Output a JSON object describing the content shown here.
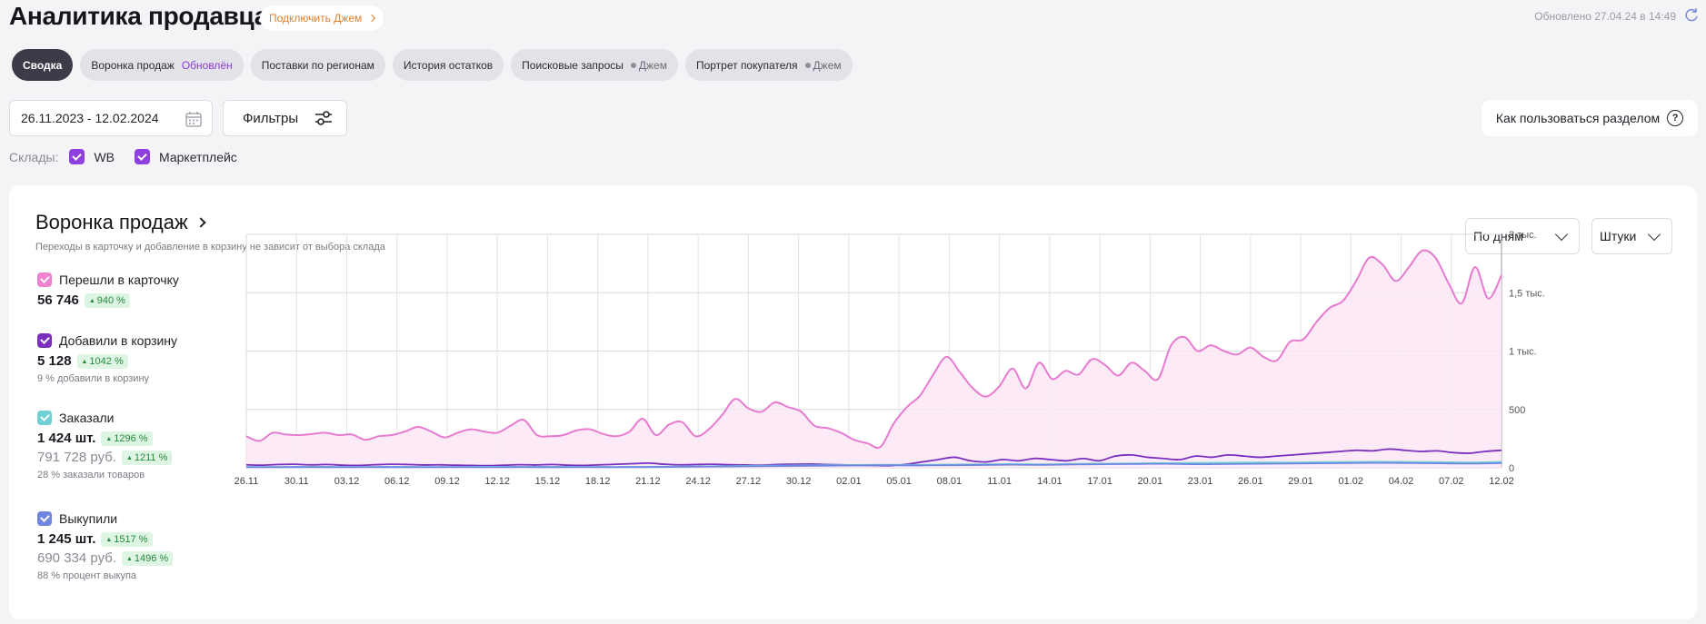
{
  "header": {
    "title": "Аналитика продавца",
    "jam_link": "Подключить Джем",
    "updated": "Обновлено 27.04.24 в 14:49"
  },
  "tabs": [
    {
      "label": "Сводка",
      "active": true
    },
    {
      "label": "Воронка продаж",
      "badge": "Обновлён"
    },
    {
      "label": "Поставки по регионам"
    },
    {
      "label": "История остатков"
    },
    {
      "label": "Поисковые запросы",
      "jam": "Джем"
    },
    {
      "label": "Портрет покупателя",
      "jam": "Джем"
    }
  ],
  "filters": {
    "date_range": "26.11.2023 - 12.02.2024",
    "filters_label": "Фильтры",
    "help_label": "Как пользоваться разделом",
    "warehouses_label": "Склады:",
    "warehouses": [
      "WB",
      "Маркетплейс"
    ]
  },
  "card": {
    "title": "Воронка продаж",
    "subtitle": "Переходы в карточку и добавление в корзину не зависит от выбора склада",
    "period_select": "По дням",
    "unit_select": "Штуки"
  },
  "legend": [
    {
      "label": "Перешли в карточку",
      "value": "56 746",
      "change": "940 %",
      "color": "#f080d0"
    },
    {
      "label": "Добавили в корзину",
      "value": "5 128",
      "change": "1042 %",
      "note": "9 % добавили в корзину",
      "color": "#7b2fbf"
    },
    {
      "label": "Заказали",
      "value": "1 424 шт.",
      "change": "1296 %",
      "value2": "791 728 руб.",
      "change2": "1211 %",
      "note": "28 % заказали товаров",
      "color": "#6fd0d6"
    },
    {
      "label": "Выкупили",
      "value": "1 245 шт.",
      "change": "1517 %",
      "value2": "690 334 руб.",
      "change2": "1496 %",
      "note": "88 % процент выкупа",
      "color": "#6f86e0"
    }
  ],
  "chart_data": {
    "type": "line",
    "x_tick_labels": [
      "26.11",
      "30.11",
      "03.12",
      "06.12",
      "09.12",
      "12.12",
      "15.12",
      "18.12",
      "21.12",
      "24.12",
      "27.12",
      "30.12",
      "02.01",
      "05.01",
      "08.01",
      "11.01",
      "14.01",
      "17.01",
      "20.01",
      "23.01",
      "26.01",
      "29.01",
      "01.02",
      "04.02",
      "07.02",
      "12.02"
    ],
    "y_tick_labels": [
      "0",
      "500",
      "1 тыс.",
      "1,5 тыс.",
      "2 тыс."
    ],
    "ylim": [
      0,
      2000
    ],
    "series": [
      {
        "name": "Перешли в карточку",
        "color": "#e77bd0",
        "fill": "#fbe6f5",
        "values": [
          270,
          230,
          300,
          285,
          280,
          290,
          300,
          280,
          285,
          240,
          270,
          280,
          310,
          350,
          310,
          260,
          300,
          330,
          310,
          300,
          360,
          410,
          280,
          270,
          280,
          320,
          330,
          290,
          270,
          310,
          420,
          280,
          370,
          390,
          270,
          330,
          450,
          590,
          510,
          480,
          560,
          520,
          480,
          360,
          340,
          300,
          240,
          210,
          180,
          380,
          520,
          620,
          800,
          950,
          820,
          680,
          610,
          700,
          850,
          680,
          900,
          760,
          830,
          800,
          930,
          880,
          790,
          900,
          830,
          760,
          1050,
          1120,
          1000,
          1050,
          1000,
          970,
          1030,
          950,
          920,
          1080,
          1100,
          1250,
          1370,
          1430,
          1600,
          1800,
          1740,
          1600,
          1720,
          1860,
          1800,
          1580,
          1410,
          1720,
          1450,
          1650
        ],
        "note": "approximate readings"
      },
      {
        "name": "Добавили в корзину",
        "color": "#7b2fbf",
        "values": [
          25,
          22,
          28,
          30,
          25,
          28,
          22,
          20,
          26,
          30,
          28,
          24,
          25,
          22,
          20,
          18,
          22,
          26,
          24,
          28,
          22,
          20,
          25,
          30,
          35,
          40,
          30,
          25,
          28,
          30,
          26,
          24,
          22,
          28,
          30,
          32,
          28,
          25,
          22,
          20,
          18,
          30,
          50,
          70,
          90,
          60,
          50,
          70,
          60,
          80,
          70,
          60,
          80,
          60,
          100,
          110,
          90,
          80,
          70,
          100,
          90,
          110,
          100,
          90,
          100,
          110,
          120,
          130,
          140,
          150,
          145,
          160,
          150,
          140,
          145,
          130,
          125,
          140,
          150
        ],
        "note": "approximate readings"
      },
      {
        "name": "Заказали",
        "color": "#6fd0d6",
        "values": [
          8,
          8,
          9,
          8,
          8,
          9,
          8,
          8,
          9,
          8,
          9,
          8,
          8,
          9,
          10,
          12,
          15,
          18,
          20,
          22,
          24,
          26,
          25,
          28,
          30,
          32,
          30,
          34,
          36,
          38,
          40,
          42,
          44,
          46,
          45,
          48,
          50,
          52,
          50,
          48,
          46,
          50
        ],
        "note": "approximate readings"
      },
      {
        "name": "Выкупили",
        "color": "#6f86e0",
        "values": [
          5,
          5,
          6,
          5,
          6,
          5,
          5,
          6,
          5,
          6,
          5,
          6,
          5,
          6,
          8,
          10,
          12,
          14,
          16,
          18,
          20,
          22,
          20,
          22,
          24,
          26,
          25,
          28,
          30,
          32,
          34,
          30,
          32,
          34,
          36,
          38,
          40,
          42,
          40,
          38,
          36,
          40
        ],
        "note": "approximate readings"
      }
    ]
  }
}
